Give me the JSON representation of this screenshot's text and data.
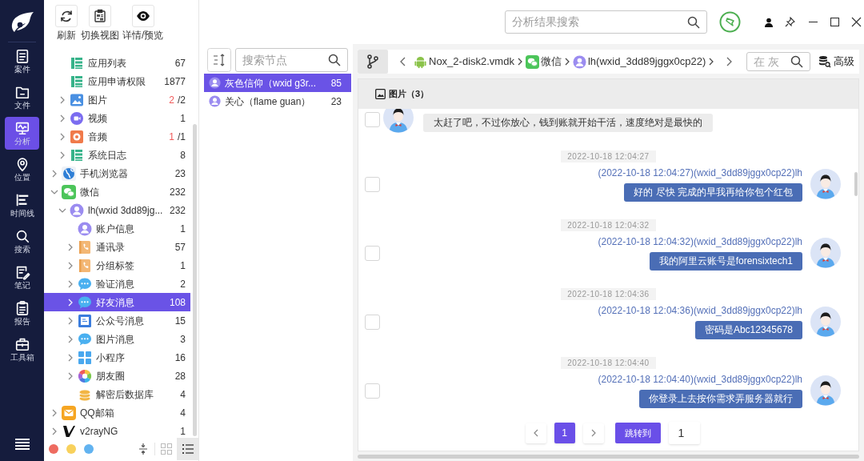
{
  "rail": {
    "items": [
      {
        "label": "案件",
        "kind": "case",
        "selected": false
      },
      {
        "label": "文件",
        "kind": "folder",
        "selected": false
      },
      {
        "label": "分析",
        "kind": "monitor",
        "selected": true
      },
      {
        "label": "位置",
        "kind": "pin",
        "selected": false
      },
      {
        "label": "时间线",
        "kind": "timeline",
        "selected": false
      },
      {
        "label": "搜索",
        "kind": "search",
        "selected": false
      },
      {
        "label": "笔记",
        "kind": "note",
        "selected": false
      },
      {
        "label": "报告",
        "kind": "report",
        "selected": false
      },
      {
        "label": "工具箱",
        "kind": "toolbox",
        "selected": false
      }
    ]
  },
  "toolbar": {
    "buttons": [
      {
        "label": "刷新",
        "kind": "refresh"
      },
      {
        "label": "切换视图",
        "kind": "switch"
      },
      {
        "label": "详情/预览",
        "kind": "eye"
      }
    ]
  },
  "tree": [
    {
      "children": [
        {
          "label": "应用列表",
          "kind": "list",
          "count": "67",
          "selected": false
        },
        {
          "label": "应用申请权限",
          "kind": "list",
          "count": "1877",
          "selected": false
        },
        {
          "label": "图片",
          "kind": "image",
          "unread": "2",
          "count": "/2",
          "expanded": false,
          "selected": false
        },
        {
          "label": "视频",
          "kind": "video",
          "count": "1",
          "expanded": false,
          "selected": false
        },
        {
          "label": "音频",
          "kind": "audio",
          "unread": "1",
          "count": "/1",
          "expanded": false,
          "selected": false
        },
        {
          "label": "系统日志",
          "kind": "list",
          "count": "8",
          "expanded": false,
          "selected": false
        }
      ]
    },
    {
      "label": "手机浏览器",
      "kind": "browser",
      "count": "23",
      "expanded": false,
      "selected": false
    },
    {
      "label": "微信",
      "kind": "wechat",
      "count": "232",
      "expanded": true,
      "selected": false,
      "children": [
        {
          "label": "lh(wxid 3dd89jg...",
          "kind": "user",
          "count": "232",
          "expanded": true,
          "selected": false,
          "children": [
            {
              "label": "账户信息",
              "kind": "user",
              "count": "1",
              "selected": false
            },
            {
              "label": "通讯录",
              "kind": "contacts",
              "count": "57",
              "expanded": false,
              "selected": false
            },
            {
              "label": "分组标签",
              "kind": "contacts",
              "count": "1",
              "expanded": false,
              "selected": false
            },
            {
              "label": "验证消息",
              "kind": "chat",
              "count": "2",
              "expanded": false,
              "selected": false
            },
            {
              "label": "好友消息",
              "kind": "chat",
              "count": "108",
              "expanded": false,
              "selected": true
            },
            {
              "label": "公众号消息",
              "kind": "article",
              "count": "15",
              "expanded": false,
              "selected": false
            },
            {
              "label": "图片消息",
              "kind": "chat",
              "count": "3",
              "expanded": false,
              "selected": false
            },
            {
              "label": "小程序",
              "kind": "apps",
              "count": "16",
              "expanded": false,
              "selected": false
            },
            {
              "label": "朋友圈",
              "kind": "moments",
              "count": "28",
              "expanded": false,
              "selected": false
            },
            {
              "label": "解密后数据库",
              "kind": "database",
              "count": "4",
              "selected": false
            }
          ]
        }
      ]
    },
    {
      "label": "QQ邮箱",
      "kind": "mail",
      "count": "4",
      "expanded": false,
      "selected": false
    },
    {
      "label": "v2rayNG",
      "kind": "v",
      "count": "1",
      "expanded": false,
      "selected": false
    }
  ],
  "tree_footer": {
    "dots": [
      {
        "color": "#ee6b60"
      },
      {
        "color": "#f8d15c"
      },
      {
        "color": "#62b3f0"
      }
    ],
    "views": [
      {
        "kind": "grid",
        "selected": false
      },
      {
        "kind": "list",
        "selected": true
      }
    ]
  },
  "header": {
    "search": {
      "placeholder": "分析结果搜索"
    }
  },
  "node_search": {
    "placeholder": "搜索节点"
  },
  "contacts": [
    {
      "label": "灰色信仰（wxid g3r...",
      "count": "85",
      "selected": true
    },
    {
      "label": "关心（flame guan）",
      "count": "23",
      "selected": false
    }
  ],
  "breadcrumb": [
    {
      "label": "Nox_2-disk2.vmdk",
      "kind": "android"
    },
    {
      "label": "微信",
      "kind": "wechat"
    },
    {
      "label": "lh(wxid_3dd89jggx0cp22)",
      "kind": "user"
    }
  ],
  "crumb_search": {
    "placeholder": "在 灰"
  },
  "advanced": "高级",
  "section": {
    "label": "图片（3）"
  },
  "messages": [
    {
      "kind": "received",
      "text": "太赶了吧，不过你放心，钱到账就开始干活，速度绝对是最快的",
      "checked": false
    },
    {
      "kind": "time",
      "text": "2022-10-18 12:04:27"
    },
    {
      "kind": "sent",
      "sender": "(2022-10-18 12:04:27)(wxid_3dd89jggx0cp22)lh",
      "text": "好的 尽快 完成的早我再给你包个红包",
      "checked": false
    },
    {
      "kind": "time",
      "text": "2022-10-18 12:04:32"
    },
    {
      "kind": "sent",
      "sender": "(2022-10-18 12:04:32)(wxid_3dd89jggx0cp22)lh",
      "text": "我的阿里云账号是forensixtech1",
      "checked": false
    },
    {
      "kind": "time",
      "text": "2022-10-18 12:04:36"
    },
    {
      "kind": "sent",
      "sender": "(2022-10-18 12:04:36)(wxid_3dd89jggx0cp22)lh",
      "text": "密码是Abc12345678",
      "checked": false
    },
    {
      "kind": "time",
      "text": "2022-10-18 12:04:40"
    },
    {
      "kind": "sent",
      "sender": "(2022-10-18 12:04:40)(wxid_3dd89jggx0cp22)lh",
      "text": "你登录上去按你需求弄服务器就行",
      "checked": false
    }
  ],
  "pagination": {
    "pages": [
      {
        "label": "1",
        "selected": true
      }
    ],
    "jump_label": "跳转到",
    "jump_value": "1"
  }
}
